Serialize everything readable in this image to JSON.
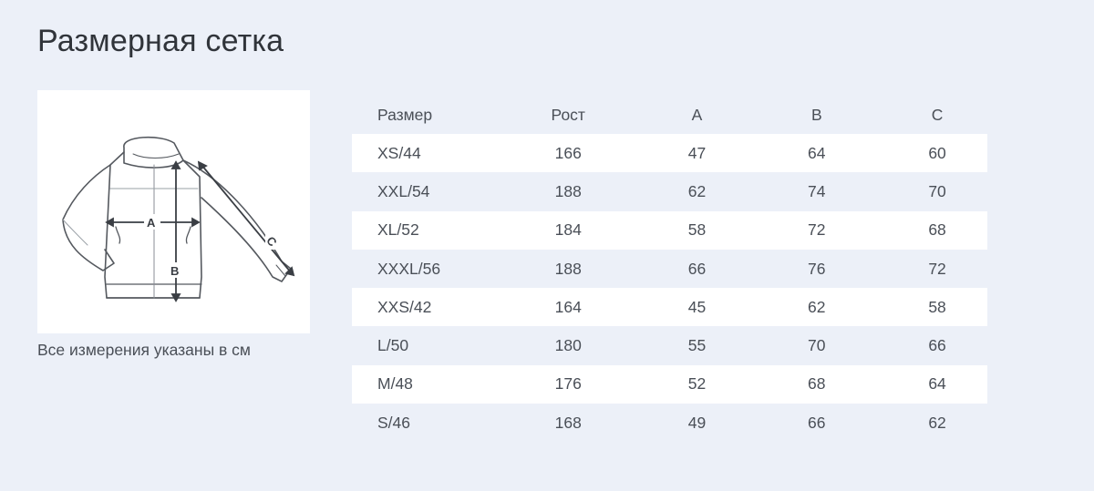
{
  "page": {
    "title": "Размерная сетка",
    "caption": "Все измерения указаны в см"
  },
  "diagram": {
    "icon": "jacket-measurement-icon",
    "labels": {
      "a": "A",
      "b": "B",
      "c": "C"
    }
  },
  "table": {
    "headers": [
      "Размер",
      "Рост",
      "A",
      "B",
      "C"
    ],
    "rows": [
      [
        "XS/44",
        "166",
        "47",
        "64",
        "60"
      ],
      [
        "XXL/54",
        "188",
        "62",
        "74",
        "70"
      ],
      [
        "XL/52",
        "184",
        "58",
        "72",
        "68"
      ],
      [
        "XXXL/56",
        "188",
        "66",
        "76",
        "72"
      ],
      [
        "XXS/42",
        "164",
        "45",
        "62",
        "58"
      ],
      [
        "L/50",
        "180",
        "55",
        "70",
        "66"
      ],
      [
        "M/48",
        "176",
        "52",
        "68",
        "64"
      ],
      [
        "S/46",
        "168",
        "49",
        "66",
        "62"
      ]
    ]
  },
  "colors": {
    "background": "#ecf0f8",
    "row_highlight": "#ffffff",
    "text": "#4a4f57"
  }
}
